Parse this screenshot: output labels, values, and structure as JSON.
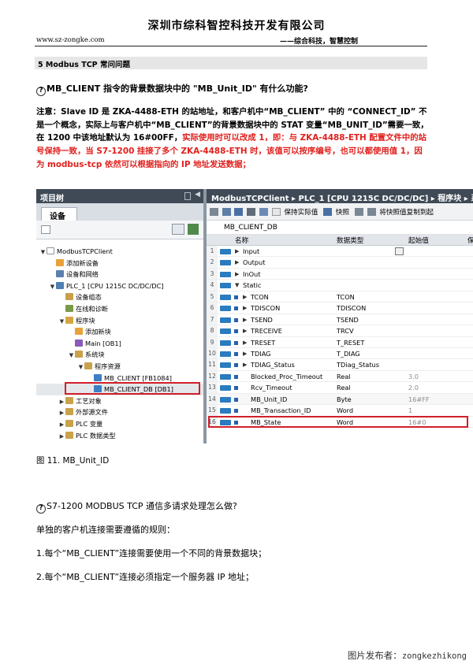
{
  "header": {
    "company": "深圳市综科智控科技开发有限公司",
    "url": "www.sz-zongke.com",
    "slogan": "——综合科技，智慧控制"
  },
  "section": {
    "title": "5 Modbus TCP 常问问题"
  },
  "question1": {
    "icon": "question-mark-icon",
    "text": "MB_CLIENT 指令的背景数据块中的 \"MB_Unit_ID\" 有什么功能?"
  },
  "note": {
    "part1": "注意：Slave ID 是 ZKA-4488-ETH 的站地址，和客户机中“MB_CLIENT” 中的 “CONNECT_ID” 不是一个概念，实际上与客户机中“MB_CLIENT”的背景数据块中的 STAT 变量“MB_UNIT_ID”需要一致，在 1200 中该地址默认为 16#00FF，",
    "part2": "实际使用时可以改成 1，即：与 ZKA-4488-ETH 配置文件中的站号保持一致，当 S7-1200 挂接了多个 ZKA-4488-ETH 时，该值可以按序编号，也可以都使用值 1，因为 modbus-tcp 依然可以根据指向的 IP 地址发送数据；"
  },
  "screenshot": {
    "left_panel": {
      "title": "项目树",
      "tab": "设备",
      "tree": [
        {
          "label": "ModbusTCPClient",
          "indent": 0,
          "twisty": "▼",
          "icon_color": "#ffffff"
        },
        {
          "label": "添加新设备",
          "indent": 1,
          "twisty": "",
          "icon_color": "#e8a23a"
        },
        {
          "label": "设备和网络",
          "indent": 1,
          "twisty": "",
          "icon_color": "#5b7fb0"
        },
        {
          "label": "PLC_1 [CPU 1215C DC/DC/DC]",
          "indent": 1,
          "twisty": "▼",
          "icon_color": "#4d7fb3"
        },
        {
          "label": "设备组态",
          "indent": 2,
          "twisty": "",
          "icon_color": "#c8a04a"
        },
        {
          "label": "在线和诊断",
          "indent": 2,
          "twisty": "",
          "icon_color": "#7a9a4a"
        },
        {
          "label": "程序块",
          "indent": 2,
          "twisty": "▼",
          "icon_color": "#d4a642"
        },
        {
          "label": "添加新块",
          "indent": 3,
          "twisty": "",
          "icon_color": "#e8a23a"
        },
        {
          "label": "Main [OB1]",
          "indent": 3,
          "twisty": "",
          "icon_color": "#8a5ab8"
        },
        {
          "label": "系统块",
          "indent": 3,
          "twisty": "▼",
          "icon_color": "#c9a24a"
        },
        {
          "label": "程序资源",
          "indent": 4,
          "twisty": "▼",
          "icon_color": "#c9a24a"
        },
        {
          "label": "MB_CLIENT [FB1084]",
          "indent": 5,
          "twisty": "",
          "icon_color": "#3f7ec2"
        },
        {
          "label": "MB_CLIENT_DB [DB1]",
          "indent": 5,
          "twisty": "",
          "icon_color": "#3f7ec2",
          "selected": true
        },
        {
          "label": "工艺对象",
          "indent": 2,
          "twisty": "▶",
          "icon_color": "#c9a24a"
        },
        {
          "label": "外部源文件",
          "indent": 2,
          "twisty": "▶",
          "icon_color": "#c9a24a"
        },
        {
          "label": "PLC 变量",
          "indent": 2,
          "twisty": "▶",
          "icon_color": "#c9a24a"
        },
        {
          "label": "PLC 数据类型",
          "indent": 2,
          "twisty": "▶",
          "icon_color": "#c9a24a"
        }
      ]
    },
    "right_panel": {
      "breadcrumb": "ModbusTCPClient ▸ PLC_1 [CPU 1215C DC/DC/DC] ▸ 程序块 ▸ 系统",
      "toolbar": {
        "keep_actual": "保持实际值",
        "snapshot": "快照",
        "copy_snapshot": "将快照值复制到起"
      },
      "db_name": "MB_CLIENT_DB",
      "columns": {
        "name": "名称",
        "type": "数据类型",
        "start": "起始值",
        "retain": "保"
      },
      "rows": [
        {
          "n": "1",
          "name": "Input",
          "type": "",
          "start": "",
          "level": 0,
          "tog": "▶"
        },
        {
          "n": "2",
          "name": "Output",
          "type": "",
          "start": "",
          "level": 0,
          "tog": "▶"
        },
        {
          "n": "3",
          "name": "InOut",
          "type": "",
          "start": "",
          "level": 0,
          "tog": "▶"
        },
        {
          "n": "4",
          "name": "Static",
          "type": "",
          "start": "",
          "level": 0,
          "tog": "▼"
        },
        {
          "n": "5",
          "name": "TCON",
          "type": "TCON",
          "start": "",
          "level": 1,
          "tog": "▶"
        },
        {
          "n": "6",
          "name": "TDISCON",
          "type": "TDISCON",
          "start": "",
          "level": 1,
          "tog": "▶"
        },
        {
          "n": "7",
          "name": "TSEND",
          "type": "TSEND",
          "start": "",
          "level": 1,
          "tog": "▶"
        },
        {
          "n": "8",
          "name": "TRECEIVE",
          "type": "TRCV",
          "start": "",
          "level": 1,
          "tog": "▶"
        },
        {
          "n": "9",
          "name": "TRESET",
          "type": "T_RESET",
          "start": "",
          "level": 1,
          "tog": "▶"
        },
        {
          "n": "10",
          "name": "TDIAG",
          "type": "T_DIAG",
          "start": "",
          "level": 1,
          "tog": "▶"
        },
        {
          "n": "11",
          "name": "TDIAG_Status",
          "type": "TDiag_Status",
          "start": "",
          "level": 1,
          "tog": "▶"
        },
        {
          "n": "12",
          "name": "Blocked_Proc_Timeout",
          "type": "Real",
          "start": "3.0",
          "level": 1,
          "tog": ""
        },
        {
          "n": "13",
          "name": "Rcv_Timeout",
          "type": "Real",
          "start": "2.0",
          "level": 1,
          "tog": ""
        },
        {
          "n": "14",
          "name": "MB_Unit_ID",
          "type": "Byte",
          "start": "16#FF",
          "level": 1,
          "tog": "",
          "highlight": true
        },
        {
          "n": "15",
          "name": "MB_Transaction_ID",
          "type": "Word",
          "start": "1",
          "level": 1,
          "tog": ""
        },
        {
          "n": "16",
          "name": "MB_State",
          "type": "Word",
          "start": "16#0",
          "level": 1,
          "tog": ""
        }
      ]
    }
  },
  "caption": "图 11. MB_Unit_ID",
  "question2": {
    "icon": "question-mark-icon",
    "text": "S7-1200 MODBUS TCP 通信多请求处理怎么做?"
  },
  "paragraphs": [
    "单独的客户机连接需要遵循的规则：",
    "1.每个“MB_CLIENT”连接需要使用一个不同的背景数据块；",
    "2.每个“MB_CLIENT”连接必须指定一个服务器 IP 地址；"
  ],
  "footer": {
    "label": "图片发布者：",
    "user": "zongkezhikong"
  }
}
